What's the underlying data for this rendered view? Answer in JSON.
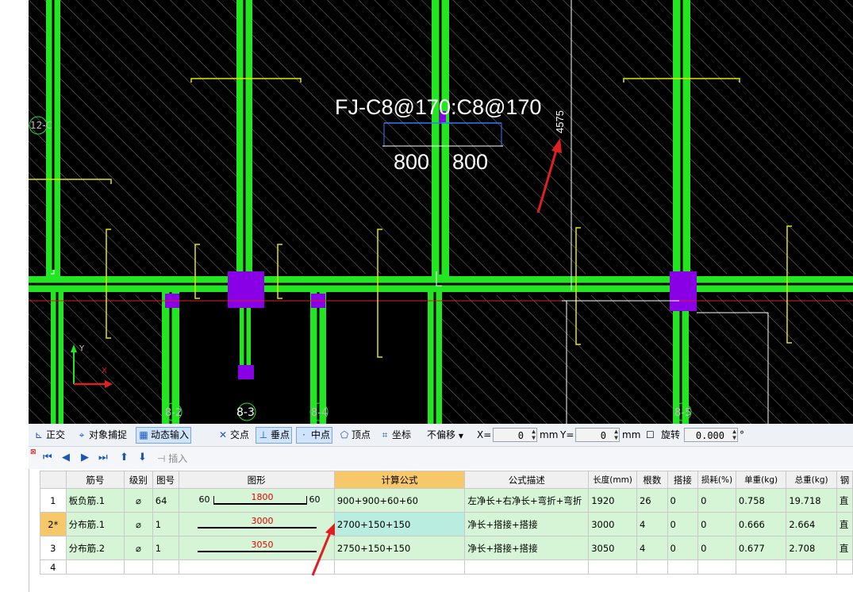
{
  "canvas": {
    "rebar_label": "FJ-C8@170:C8@170",
    "dim_left": "800",
    "dim_right": "800",
    "dim_vertical": "4575",
    "axis_labels": [
      "12-C",
      "8-2",
      "8-3",
      "8-4",
      "8-5"
    ],
    "axis_y": "Y",
    "axis_x": "X"
  },
  "toolbar": {
    "ortho": "正交",
    "snap": "对象捕捉",
    "dynamic_input": "动态输入",
    "intersection": "交点",
    "perpendicular": "垂点",
    "midpoint": "中点",
    "vertex": "顶点",
    "coordinate": "坐标",
    "offset_select": "不偏移",
    "x_label": "X=",
    "x_value": "0",
    "x_unit": "mm",
    "y_label": "Y=",
    "y_value": "0",
    "y_unit": "mm",
    "rotate_label": "旋转",
    "rotate_value": "0.000",
    "degree": "°"
  },
  "nav": {
    "insert": "插入"
  },
  "table": {
    "headers": [
      "筋号",
      "级别",
      "图号",
      "图形",
      "计算公式",
      "公式描述",
      "长度(mm)",
      "根数",
      "搭接",
      "损耗(%)",
      "单重(kg)",
      "总重(kg)",
      "钢"
    ],
    "rows": [
      {
        "no": "1",
        "name": "板负筋.1",
        "grade": "⌀",
        "fig": "64",
        "shape_left": "60",
        "shape_value": "1800",
        "shape_right": "60",
        "formula": "900+900+60+60",
        "desc": "左净长+右净长+弯折+弯折",
        "length": "1920",
        "count": "26",
        "lap": "0",
        "loss": "0",
        "unit_w": "0.758",
        "total_w": "19.718",
        "type": "直"
      },
      {
        "no": "2*",
        "name": "分布筋.1",
        "grade": "⌀",
        "fig": "1",
        "shape_left": "",
        "shape_value": "3000",
        "shape_right": "",
        "formula": "2700+150+150",
        "desc": "净长+搭接+搭接",
        "length": "3000",
        "count": "4",
        "lap": "0",
        "loss": "0",
        "unit_w": "0.666",
        "total_w": "2.664",
        "type": "直"
      },
      {
        "no": "3",
        "name": "分布筋.2",
        "grade": "⌀",
        "fig": "1",
        "shape_left": "",
        "shape_value": "3050",
        "shape_right": "",
        "formula": "2750+150+150",
        "desc": "净长+搭接+搭接",
        "length": "3050",
        "count": "4",
        "lap": "0",
        "loss": "0",
        "unit_w": "0.677",
        "total_w": "2.708",
        "type": "直"
      },
      {
        "no": "4"
      }
    ]
  },
  "colors": {
    "beam": "#22e622",
    "column": "#8a00e6",
    "dim_blue": "#2e7cff",
    "annotation_red": "#e02020",
    "header_highlight": "#f7c86a",
    "row_bg": "#d6f5d6"
  }
}
